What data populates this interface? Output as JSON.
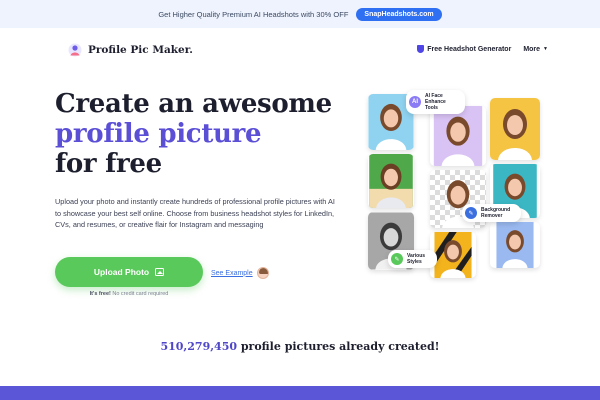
{
  "promo": {
    "text": "Get Higher Quality Premium AI Headshots with 30% OFF",
    "button": "SnapHeadshots.com"
  },
  "nav": {
    "brand": "Profile Pic Maker.",
    "headshot_link": "Free Headshot Generator",
    "more": "More"
  },
  "hero": {
    "line1": "Create an awesome",
    "line2": "profile picture",
    "line3": "for free",
    "description": "Upload your photo and instantly create hundreds of professional profile pictures with AI to showcase your best self online. Choose from business headshot styles for LinkedIn, CVs, and resumes, or creative flair for Instagram and messaging",
    "upload_button": "Upload Photo",
    "see_example": "See Example",
    "free_label": "It's free!",
    "no_card": "No credit card required"
  },
  "collage": {
    "bubble_ai": "AI Face Enhance Tools",
    "bubble_ai_icon": "AI",
    "bubble_bg": "Background Remover",
    "bubble_styles": "Various Styles",
    "tiles": [
      {
        "bg": "#8fd3f0"
      },
      {
        "bg": "#d9c3f5"
      },
      {
        "bg": "#f5c443"
      },
      {
        "bg": "#4fa84a"
      },
      {
        "bg": "checker"
      },
      {
        "bg": "#3bb7c4"
      },
      {
        "bg": "#9a9a9a"
      },
      {
        "bg": "#f2b31c"
      },
      {
        "bg": "#9ab9f0"
      }
    ]
  },
  "stats": {
    "count": "510,279,450",
    "label": "profile pictures already created!"
  },
  "colors": {
    "accent": "#5b4fd6",
    "green": "#5ac95b",
    "promo_button": "#2f6ff2"
  }
}
